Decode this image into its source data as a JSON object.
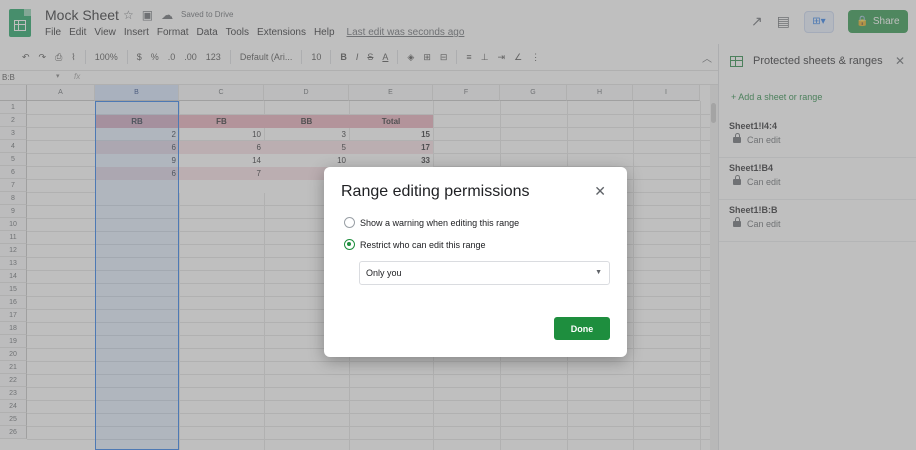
{
  "header": {
    "title": "Mock Sheet",
    "saved_status": "Saved to Drive",
    "menu": [
      "File",
      "Edit",
      "View",
      "Insert",
      "Format",
      "Data",
      "Tools",
      "Extensions",
      "Help"
    ],
    "last_edit": "Last edit was seconds ago",
    "share_label": "Share"
  },
  "toolbar": {
    "zoom": "100%",
    "currency": "$",
    "percent": "%",
    "dec_less": ".0",
    "dec_more": ".00",
    "number_format": "123",
    "font": "Default (Ari...",
    "font_size": "10",
    "bold": "B",
    "italic": "I",
    "strike": "S",
    "text_color": "A"
  },
  "formula_bar": {
    "name_box": "B:B",
    "fx": "fx"
  },
  "grid": {
    "columns": [
      "A",
      "B",
      "C",
      "D",
      "E",
      "F",
      "G",
      "H",
      "I"
    ],
    "rows": [
      "1",
      "2",
      "3",
      "4",
      "5",
      "6",
      "7",
      "8",
      "9",
      "10",
      "11",
      "12",
      "13",
      "14",
      "15",
      "16",
      "17",
      "18",
      "19",
      "20",
      "21",
      "22",
      "23",
      "24",
      "25",
      "26"
    ],
    "table_headers": [
      "RB",
      "FB",
      "BB",
      "Total"
    ],
    "table_rows": [
      [
        "2",
        "10",
        "3",
        "15"
      ],
      [
        "6",
        "6",
        "5",
        "17"
      ],
      [
        "9",
        "14",
        "10",
        "33"
      ],
      [
        "6",
        "7",
        "",
        ""
      ]
    ]
  },
  "side_panel": {
    "title": "Protected sheets & ranges",
    "add_label": "+ Add a sheet or range",
    "ranges": [
      {
        "name": "Sheet1!I4:4",
        "permission": "Can edit"
      },
      {
        "name": "Sheet1!B4",
        "permission": "Can edit"
      },
      {
        "name": "Sheet1!B:B",
        "permission": "Can edit"
      }
    ]
  },
  "dialog": {
    "title": "Range editing permissions",
    "option_warning": "Show a warning when editing this range",
    "option_restrict": "Restrict who can edit this range",
    "selected_option": "restrict",
    "select_value": "Only you",
    "done_label": "Done"
  },
  "colors": {
    "accent_green": "#1e8e3e",
    "header_band": "#e6a8b6",
    "selection_blue": "#1a73e8"
  }
}
